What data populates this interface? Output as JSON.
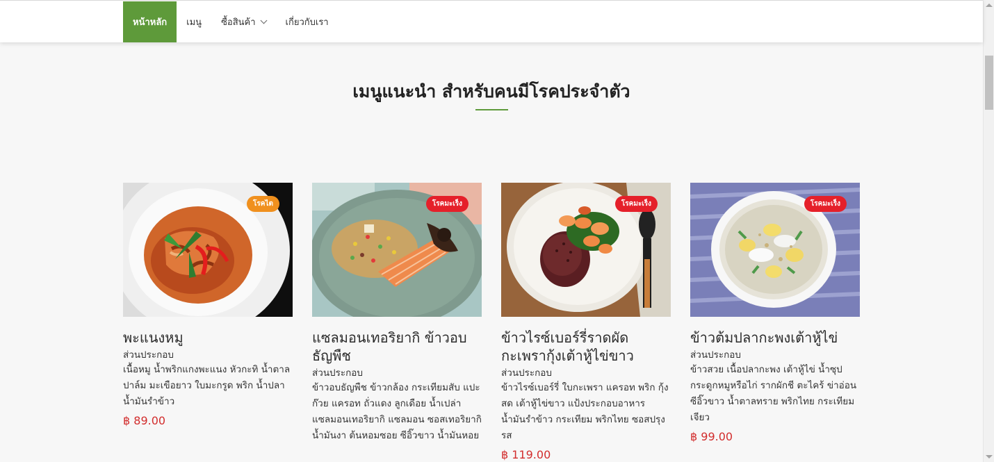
{
  "nav": {
    "items": [
      {
        "label": "หน้าหลัก",
        "active": true
      },
      {
        "label": "เมนู",
        "active": false
      },
      {
        "label": "ซื้อสินค้า",
        "active": false,
        "dropdown": true
      },
      {
        "label": "เกี่ยวกับเรา",
        "active": false
      }
    ],
    "active_color": "#5e9a3a"
  },
  "section": {
    "title": "เมนูแนะนำ สำหรับคนมีโรคประจำตัว",
    "accent_color": "#5e9a3a"
  },
  "cards": [
    {
      "badge": "โรคไต",
      "badge_color": "#f0901e",
      "title": "พะแนงหมู",
      "ingredients_label": "ส่วนประกอบ",
      "ingredients": "เนื้อหมู น้ำพริกแกงพะแนง หัวกะทิ น้ำตาลปาล์ม มะเขือยาว ใบมะกรูด พริก น้ำปลา น้ำมันรำข้าว",
      "price": "฿ 89.00"
    },
    {
      "badge": "โรคมะเร็ง",
      "badge_color": "#e5202a",
      "title": "แซลมอนเทอริยากิ ข้าวอบธัญพืช",
      "ingredients_label": "ส่วนประกอบ",
      "ingredients": "ข้าวอบธัญพืช ข้าวกล้อง กระเทียมสับ แปะก๊วย แครอท ถั่วแดง ลูกเดือย น้ำเปล่า แซลมอนเทอริยากิ แซลมอน ซอสเทอริยากิ น้ำมันงา ต้นหอมซอย ซีอิ๊วขาว น้ำมันหอย",
      "price": ""
    },
    {
      "badge": "โรคมะเร็ง",
      "badge_color": "#e5202a",
      "title": "ข้าวไรซ์เบอร์รี่ราดผัดกะเพรากุ้งเต้าหู้ไข่ขาว",
      "ingredients_label": "ส่วนประกอบ",
      "ingredients": "ข้าวไรซ์เบอร์รี่ ใบกะเพรา แครอท พริก กุ้งสด เต้าหู้ไข่ขาว แป้งประกอบอาหาร น้ำมันรำข้าว กระเทียม พริกไทย ซอสปรุงรส",
      "price": "฿ 119.00"
    },
    {
      "badge": "โรคมะเร็ง",
      "badge_color": "#e5202a",
      "title": "ข้าวต้มปลากะพงเต้าหู้ไข่",
      "ingredients_label": "ส่วนประกอบ",
      "ingredients": "ข้าวสวย เนื้อปลากะพง เต้าหู้ไข่ น้ำซุปกระดูกหมูหรือไก่ รากผักชี ตะไคร้ ข่าอ่อน ซีอิ๊วขาว น้ำตาลทราย พริกไทย กระเทียมเจียว",
      "price": "฿ 99.00"
    }
  ]
}
